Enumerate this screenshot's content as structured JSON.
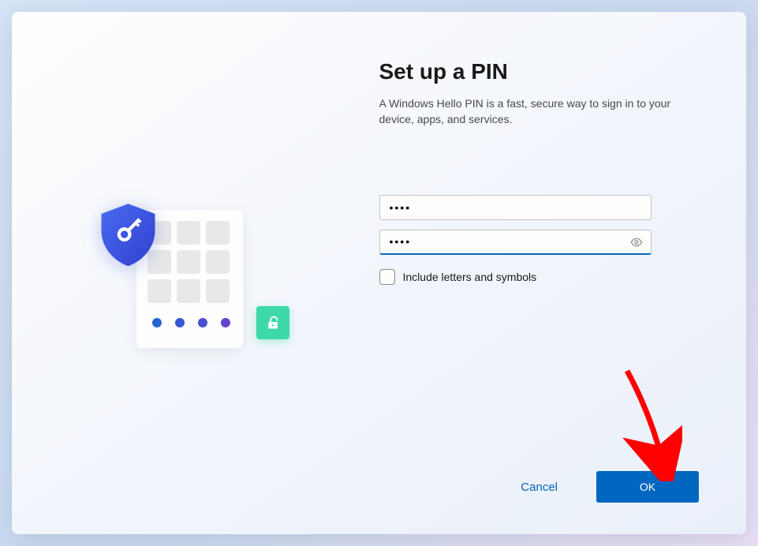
{
  "dialog": {
    "title": "Set up a PIN",
    "description": "A Windows Hello PIN is a fast, secure way to sign in to your device, apps, and services."
  },
  "inputs": {
    "pin_value": "••••",
    "confirm_value": "••••"
  },
  "checkbox": {
    "label": "Include letters and symbols",
    "checked": false
  },
  "buttons": {
    "cancel": "Cancel",
    "ok": "OK"
  },
  "colors": {
    "primary": "#0067c0",
    "accent_green": "#3dd9a8"
  }
}
